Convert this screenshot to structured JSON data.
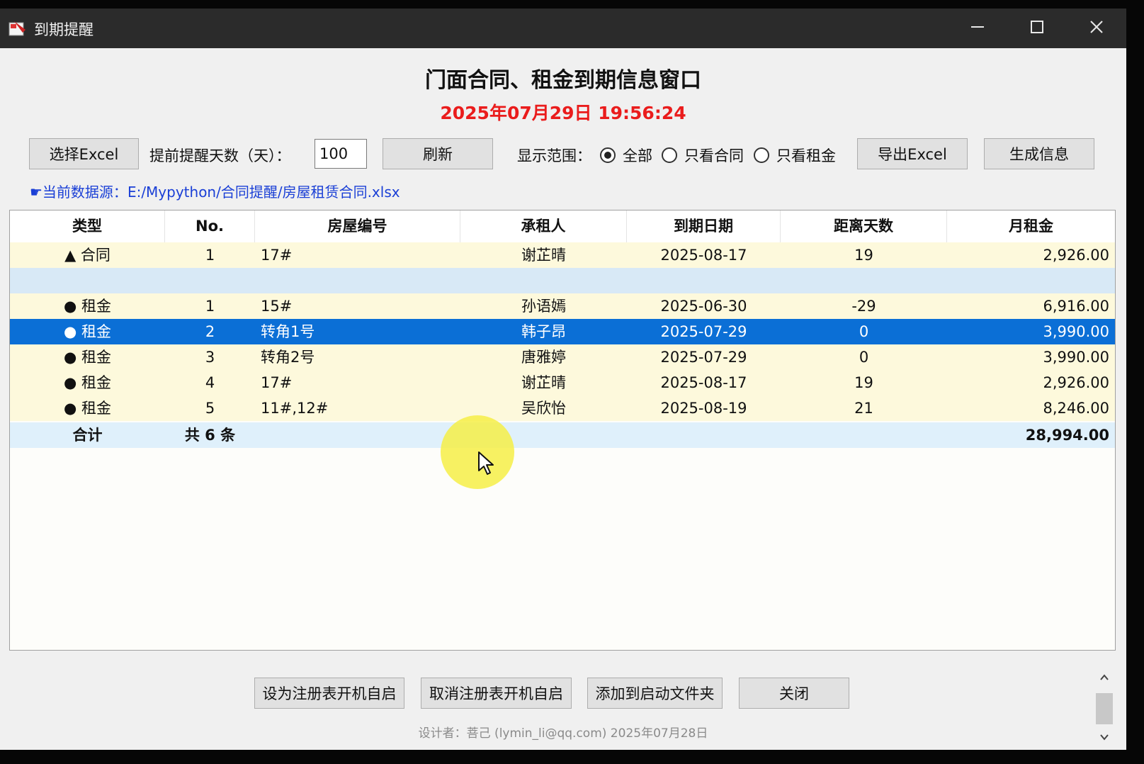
{
  "window": {
    "title": "到期提醒",
    "controls": {
      "minimize": "minimize-icon",
      "maximize": "maximize-icon",
      "close": "close-icon"
    }
  },
  "header": {
    "title": "门面合同、租金到期信息窗口",
    "datetime": "2025年07月29日  19:56:24",
    "datetime_color": "#ea1c1c"
  },
  "toolbar": {
    "select_excel": "选择Excel",
    "days_label": "提前提醒天数（天）：",
    "days_value": "100",
    "refresh": "刷新",
    "range_label": "显示范围：",
    "range_options": [
      "全部",
      "只看合同",
      "只看租金"
    ],
    "range_selected": "全部",
    "export_excel": "导出Excel",
    "generate_info": "生成信息"
  },
  "source": {
    "label": "☛当前数据源：",
    "path": "E:/Mypython/合同提醒/房屋租赁合同.xlsx"
  },
  "table": {
    "columns": [
      "类型",
      "No.",
      "房屋编号",
      "承租人",
      "到期日期",
      "距离天数",
      "月租金"
    ],
    "rows": [
      {
        "type": "▲ 合同",
        "no": "1",
        "house": "17#",
        "tenant": "谢芷晴",
        "date": "2025-08-17",
        "days": "19",
        "rent": "2,926.00"
      },
      {
        "type": "",
        "no": "",
        "house": "",
        "tenant": "",
        "date": "",
        "days": "",
        "rent": ""
      },
      {
        "type": "● 租金",
        "no": "1",
        "house": "15#",
        "tenant": "孙语嫣",
        "date": "2025-06-30",
        "days": "-29",
        "rent": "6,916.00"
      },
      {
        "type": "● 租金",
        "no": "2",
        "house": "转角1号",
        "tenant": "韩子昂",
        "date": "2025-07-29",
        "days": "0",
        "rent": "3,990.00"
      },
      {
        "type": "● 租金",
        "no": "3",
        "house": "转角2号",
        "tenant": "唐雅婷",
        "date": "2025-07-29",
        "days": "0",
        "rent": "3,990.00"
      },
      {
        "type": "● 租金",
        "no": "4",
        "house": "17#",
        "tenant": "谢芷晴",
        "date": "2025-08-17",
        "days": "19",
        "rent": "2,926.00"
      },
      {
        "type": "● 租金",
        "no": "5",
        "house": "11#,12#",
        "tenant": "吴欣怡",
        "date": "2025-08-19",
        "days": "21",
        "rent": "8,246.00"
      }
    ],
    "selected_row": 3,
    "total": {
      "label": "合计",
      "count": "共 6 条",
      "rent": "28,994.00"
    },
    "colors": {
      "row_bg": "#fdf9dc",
      "separator_bg": "#d8e9f6",
      "selected_bg": "#0b6fd6",
      "total_bg": "#dff0fb"
    }
  },
  "bottom_buttons": {
    "registry_autostart": "设为注册表开机自启",
    "cancel_registry_autostart": "取消注册表开机自启",
    "add_startup_folder": "添加到启动文件夹",
    "close": "关闭"
  },
  "footer": "设计者：菩己 (lymin_li@qq.com) 2025年07月28日"
}
